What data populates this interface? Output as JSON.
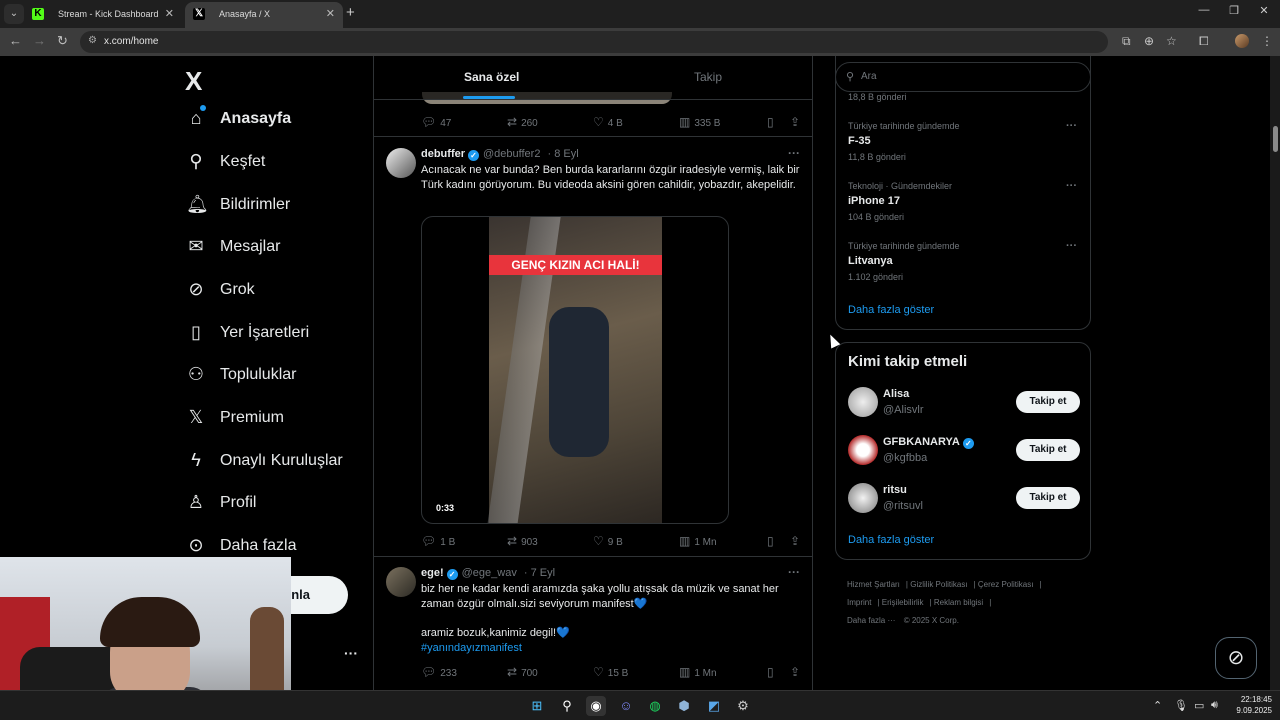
{
  "browser": {
    "tabs": [
      {
        "label": "Stream - Kick Dashboard",
        "favicon": "K",
        "active": false
      },
      {
        "label": "Anasayfa / X",
        "favicon": "X",
        "active": true
      }
    ],
    "url": "x.com/home"
  },
  "sidebar": {
    "logo": "X",
    "items": [
      {
        "label": "Anasayfa",
        "icon": "home-icon"
      },
      {
        "label": "Keşfet",
        "icon": "search-icon"
      },
      {
        "label": "Bildirimler",
        "icon": "bell-icon"
      },
      {
        "label": "Mesajlar",
        "icon": "mail-icon"
      },
      {
        "label": "Grok",
        "icon": "grok-icon"
      },
      {
        "label": "Yer İşaretleri",
        "icon": "bookmark-icon"
      },
      {
        "label": "Topluluklar",
        "icon": "people-icon"
      },
      {
        "label": "Premium",
        "icon": "x-icon"
      },
      {
        "label": "Onaylı Kuruluşlar",
        "icon": "lightning-icon"
      },
      {
        "label": "Profil",
        "icon": "person-icon"
      },
      {
        "label": "Daha fazla",
        "icon": "more-circle-icon"
      }
    ],
    "post_button": "nla",
    "more": "···"
  },
  "feed": {
    "tabs": [
      "Sana özel",
      "Takip"
    ],
    "prev_tweet_actions": {
      "replies": "47",
      "reposts": "260",
      "likes": "4 B",
      "views": "335 B"
    },
    "tweets": [
      {
        "name": "debuffer",
        "handle": "@debuffer2",
        "time": "· 8 Eyl",
        "text": "Acınacak ne var bunda? Ben burda kararlarını özgür iradesiyle vermiş, laik bir Türk kadını görüyorum. Bu videoda aksini gören cahildir, yobazdır, akepelidir.",
        "video": {
          "caption": "GENÇ KIZIN ACI HALİ!",
          "duration": "0:33"
        },
        "replies": "1 B",
        "reposts": "903",
        "likes": "9 B",
        "views": "1 Mn"
      },
      {
        "name": "ege!",
        "handle": "@ege_wav",
        "time": "· 7 Eyl",
        "text1": "biz her ne kadar kendi aramızda şaka yollu atışsak da müzik ve sanat her zaman özgür olmalı.sizi seviyorum manifest💙",
        "text2": "aramiz bozuk,kanimiz degil!💙",
        "hashtag": "#yanındayızmanifest",
        "replies": "233",
        "reposts": "700",
        "likes": "15 B",
        "views": "1 Mn"
      }
    ]
  },
  "right": {
    "search_placeholder": "Ara",
    "trends": [
      {
        "meta": "Türkiye tarihinde gündemde",
        "name": "F-35",
        "count": "11,8 B gönderi"
      },
      {
        "meta": "Teknoloji · Gündemdekiler",
        "name": "iPhone 17",
        "count": "104 B gönderi"
      },
      {
        "meta": "Türkiye tarihinde gündemde",
        "name": "Litvanya",
        "count": "1.102 gönderi"
      }
    ],
    "trend_partial": "18,8 B gönderi",
    "show_more": "Daha fazla göster",
    "who_title": "Kimi takip etmeli",
    "who": [
      {
        "name": "Alisa",
        "handle": "@Alisvlr",
        "verified": false
      },
      {
        "name": "GFBKANARYA",
        "handle": "@kgfbba",
        "verified": true
      },
      {
        "name": "ritsu",
        "handle": "@ritsuvl",
        "verified": false
      }
    ],
    "follow_label": "Takip et",
    "footer": {
      "links": [
        "Hizmet Şartları",
        "Gizlilik Politikası",
        "Çerez Politikası",
        "Imprint",
        "Erişilebilirlik",
        "Reklam bilgisi"
      ],
      "more": "Daha fazla ···",
      "copyright": "© 2025 X Corp."
    }
  },
  "taskbar": {
    "time": "22:18:45",
    "date": "9.09.2025"
  },
  "colors": {
    "accent": "#1d9bf0",
    "bg": "#000000",
    "border": "#2f3336",
    "muted": "#71767b"
  }
}
